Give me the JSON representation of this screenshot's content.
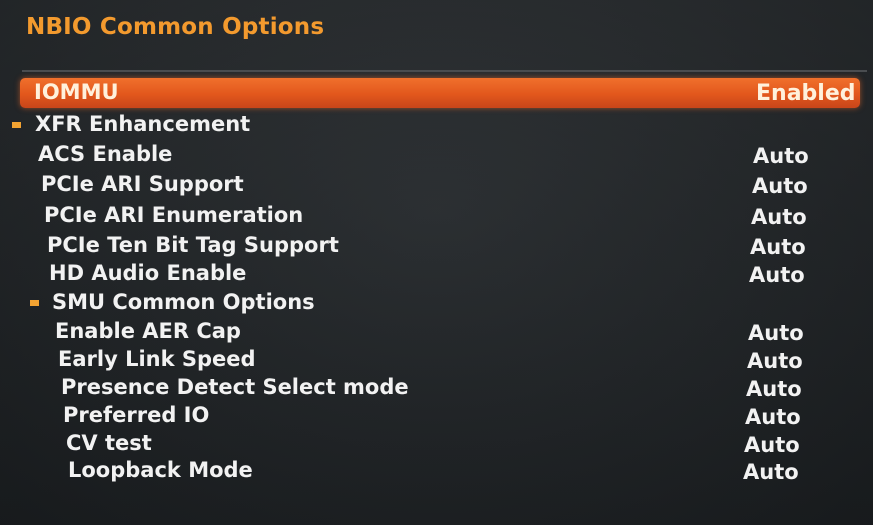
{
  "page_title": "NBIO Common Options",
  "accent_color": "#f39a2e",
  "selected_color": "#e85f22",
  "items": [
    {
      "label": "IOMMU",
      "value": "Enabled",
      "selected": true
    },
    {
      "label": "XFR Enhancement",
      "value": "",
      "submenu": true
    },
    {
      "label": "ACS Enable",
      "value": "Auto"
    },
    {
      "label": "PCIe ARI Support",
      "value": "Auto"
    },
    {
      "label": "PCIe ARI Enumeration",
      "value": "Auto"
    },
    {
      "label": "PCIe Ten Bit Tag Support",
      "value": "Auto"
    },
    {
      "label": "HD Audio Enable",
      "value": "Auto"
    },
    {
      "label": "SMU Common Options",
      "value": "",
      "submenu": true
    },
    {
      "label": "Enable AER Cap",
      "value": "Auto"
    },
    {
      "label": "Early Link Speed",
      "value": "Auto"
    },
    {
      "label": "Presence Detect Select mode",
      "value": "Auto"
    },
    {
      "label": "Preferred IO",
      "value": "Auto"
    },
    {
      "label": "CV test",
      "value": "Auto"
    },
    {
      "label": "Loopback Mode",
      "value": "Auto"
    }
  ]
}
